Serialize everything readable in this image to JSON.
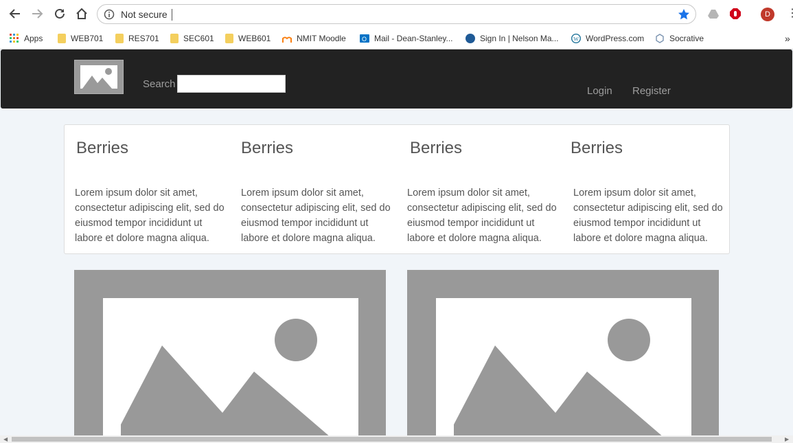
{
  "browser": {
    "omnibox": {
      "security_label": "Not secure",
      "url": ""
    },
    "profile_initial": "D",
    "bookmarks": [
      {
        "label": "Apps",
        "icon": "apps-grid-icon"
      },
      {
        "label": "WEB701",
        "icon": "folder-icon"
      },
      {
        "label": "RES701",
        "icon": "folder-icon"
      },
      {
        "label": "SEC601",
        "icon": "folder-icon"
      },
      {
        "label": "WEB601",
        "icon": "folder-icon"
      },
      {
        "label": "NMIT Moodle",
        "icon": "moodle-icon"
      },
      {
        "label": "Mail - Dean-Stanley...",
        "icon": "outlook-icon"
      },
      {
        "label": "Sign In | Nelson Ma...",
        "icon": "otm-icon"
      },
      {
        "label": "WordPress.com",
        "icon": "wordpress-icon"
      },
      {
        "label": "Socrative",
        "icon": "socrative-icon"
      }
    ],
    "overflow_chevron": "»"
  },
  "site": {
    "search_label": "Search",
    "search_value": "",
    "nav": {
      "login": "Login",
      "register": "Register"
    },
    "features": [
      {
        "title": "Berries",
        "text": "Lorem ipsum dolor sit amet, consectetur adipiscing elit, sed do eiusmod tempor incididunt ut labore et dolore magna aliqua."
      },
      {
        "title": "Berries",
        "text": "Lorem ipsum dolor sit amet, consectetur adipiscing elit, sed do eiusmod tempor incididunt ut labore et dolore magna aliqua."
      },
      {
        "title": "Berries",
        "text": "Lorem ipsum dolor sit amet, consectetur adipiscing elit, sed do eiusmod tempor incididunt ut labore et dolore magna aliqua."
      },
      {
        "title": "Berries",
        "text": "Lorem ipsum dolor sit amet, consectetur adipiscing elit, sed do eiusmod tempor incididunt ut labore et dolore magna aliqua."
      }
    ]
  },
  "colors": {
    "navbar": "#222222",
    "page_bg": "#f1f5f9",
    "placeholder": "#999999",
    "star": "#1a73e8"
  }
}
